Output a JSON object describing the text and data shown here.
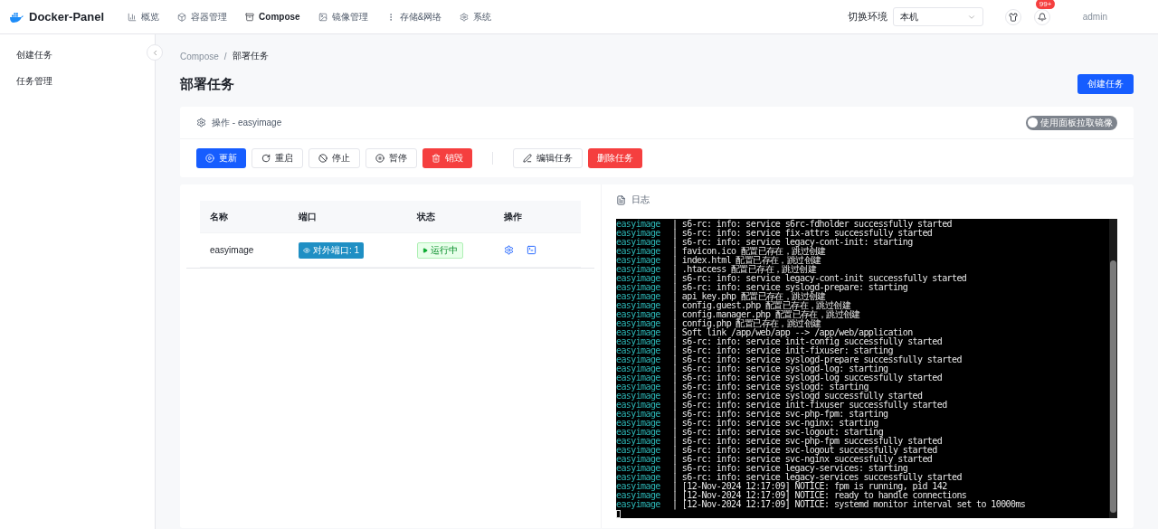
{
  "brand": "Docker-Panel",
  "nav": [
    {
      "label": "概览",
      "selected": false
    },
    {
      "label": "容器管理",
      "selected": false
    },
    {
      "label": "Compose",
      "selected": true
    },
    {
      "label": "镜像管理",
      "selected": false
    },
    {
      "label": "存储&网络",
      "selected": false
    },
    {
      "label": "系统",
      "selected": false
    }
  ],
  "env": {
    "label": "切换环境",
    "value": "本机"
  },
  "notifications": {
    "badge": "99+"
  },
  "user": "admin",
  "sidebar": {
    "items": [
      {
        "label": "创建任务",
        "selected": false
      },
      {
        "label": "任务管理",
        "selected": false
      }
    ]
  },
  "breadcrumb": {
    "items": [
      "Compose",
      "部署任务"
    ],
    "separator": "/"
  },
  "page_title": "部署任务",
  "create_button": "创建任务",
  "operation": {
    "title": "操作 - easyimage",
    "switch": {
      "label": "使用面板拉取镜像",
      "on": false
    },
    "buttons": [
      {
        "label": "更新",
        "kind": "primary"
      },
      {
        "label": "重启",
        "kind": "default"
      },
      {
        "label": "停止",
        "kind": "default"
      },
      {
        "label": "暂停",
        "kind": "default"
      },
      {
        "label": "销毁",
        "kind": "danger"
      }
    ],
    "task_buttons": [
      {
        "label": "编辑任务",
        "kind": "default"
      },
      {
        "label": "删除任务",
        "kind": "danger"
      }
    ]
  },
  "table": {
    "columns": [
      "名称",
      "端口",
      "状态",
      "操作"
    ],
    "rows": [
      {
        "name": "easyimage",
        "port": "对外端口: 1",
        "status": "运行中"
      }
    ]
  },
  "log": {
    "title": "日志",
    "lines": [
      {
        "source": "easyimage",
        "message": "| s6-rc: info: service s6rc-fdholder successfully started"
      },
      {
        "source": "easyimage",
        "message": "| s6-rc: info: service fix-attrs successfully started"
      },
      {
        "source": "easyimage",
        "message": "| s6-rc: info: service legacy-cont-init: starting"
      },
      {
        "source": "easyimage",
        "message": "| favicon.ico 配置已存在，跳过创建"
      },
      {
        "source": "easyimage",
        "message": "| index.html 配置已存在，跳过创建"
      },
      {
        "source": "easyimage",
        "message": "| .htaccess 配置已存在，跳过创建"
      },
      {
        "source": "easyimage",
        "message": "| s6-rc: info: service legacy-cont-init successfully started"
      },
      {
        "source": "easyimage",
        "message": "| s6-rc: info: service syslogd-prepare: starting"
      },
      {
        "source": "easyimage",
        "message": "| api_key.php 配置已存在，跳过创建"
      },
      {
        "source": "easyimage",
        "message": "| config.guest.php 配置已存在，跳过创建"
      },
      {
        "source": "easyimage",
        "message": "| config.manager.php 配置已存在，跳过创建"
      },
      {
        "source": "easyimage",
        "message": "| config.php 配置已存在，跳过创建"
      },
      {
        "source": "easyimage",
        "message": "| Soft link /app/web/app --> /app/web/application"
      },
      {
        "source": "easyimage",
        "message": "| s6-rc: info: service init-config successfully started"
      },
      {
        "source": "easyimage",
        "message": "| s6-rc: info: service init-fixuser: starting"
      },
      {
        "source": "easyimage",
        "message": "| s6-rc: info: service syslogd-prepare successfully started"
      },
      {
        "source": "easyimage",
        "message": "| s6-rc: info: service syslogd-log: starting"
      },
      {
        "source": "easyimage",
        "message": "| s6-rc: info: service syslogd-log successfully started"
      },
      {
        "source": "easyimage",
        "message": "| s6-rc: info: service syslogd: starting"
      },
      {
        "source": "easyimage",
        "message": "| s6-rc: info: service syslogd successfully started"
      },
      {
        "source": "easyimage",
        "message": "| s6-rc: info: service init-fixuser successfully started"
      },
      {
        "source": "easyimage",
        "message": "| s6-rc: info: service svc-php-fpm: starting"
      },
      {
        "source": "easyimage",
        "message": "| s6-rc: info: service svc-nginx: starting"
      },
      {
        "source": "easyimage",
        "message": "| s6-rc: info: service svc-logout: starting"
      },
      {
        "source": "easyimage",
        "message": "| s6-rc: info: service svc-php-fpm successfully started"
      },
      {
        "source": "easyimage",
        "message": "| s6-rc: info: service svc-logout successfully started"
      },
      {
        "source": "easyimage",
        "message": "| s6-rc: info: service svc-nginx successfully started"
      },
      {
        "source": "easyimage",
        "message": "| s6-rc: info: service legacy-services: starting"
      },
      {
        "source": "easyimage",
        "message": "| s6-rc: info: service legacy-services successfully started"
      },
      {
        "source": "easyimage",
        "message": "| [12-Nov-2024 12:17:09] NOTICE: fpm is running, pid 142"
      },
      {
        "source": "easyimage",
        "message": "| [12-Nov-2024 12:17:09] NOTICE: ready to handle connections"
      },
      {
        "source": "easyimage",
        "message": "| [12-Nov-2024 12:17:09] NOTICE: systemd monitor interval set to 10000ms"
      }
    ]
  }
}
